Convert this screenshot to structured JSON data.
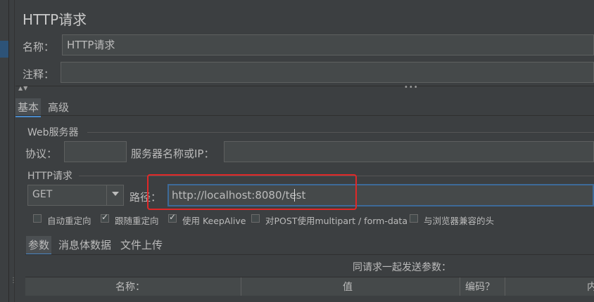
{
  "title": "HTTP请求",
  "name_label": "名称：",
  "name_value": "HTTP请求",
  "comment_label": "注释：",
  "comment_value": "",
  "main_tabs": [
    "基本",
    "高级"
  ],
  "web_server": {
    "legend": "Web服务器",
    "protocol_label": "协议：",
    "protocol_value": "",
    "server_label": "服务器名称或IP：",
    "server_value": ""
  },
  "http_request": {
    "legend": "HTTP请求",
    "method": "GET",
    "path_label": "路径：",
    "path_value": "http://localhost:8080/test"
  },
  "checkboxes": [
    {
      "label": "自动重定向",
      "checked": false
    },
    {
      "label": "跟随重定向",
      "checked": true
    },
    {
      "label": "使用 KeepAlive",
      "checked": true
    },
    {
      "label": "对POST使用multipart / form-data",
      "checked": false
    },
    {
      "label": "与浏览器兼容的头",
      "checked": false
    }
  ],
  "sub_tabs": [
    "参数",
    "消息体数据",
    "文件上传"
  ],
  "params_caption": "同请求一起发送参数：",
  "table_headers": [
    "名称：",
    "值",
    "编码？",
    "内"
  ],
  "colors": {
    "background": "#3c3f41",
    "input": "#45494a",
    "accent": "#4a88c7",
    "highlight_box": "#e02828"
  }
}
